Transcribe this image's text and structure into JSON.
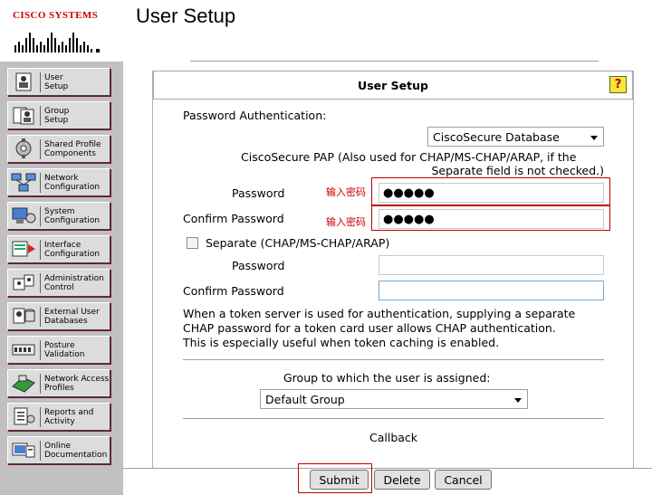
{
  "header": {
    "logo_text": "CISCO SYSTEMS",
    "page_title": "User Setup"
  },
  "sidebar": {
    "items": [
      {
        "label": "User\nSetup",
        "icon": "user-setup-icon"
      },
      {
        "label": "Group\nSetup",
        "icon": "group-setup-icon"
      },
      {
        "label": "Shared Profile\nComponents",
        "icon": "shared-profile-icon"
      },
      {
        "label": "Network\nConfiguration",
        "icon": "network-config-icon"
      },
      {
        "label": "System\nConfiguration",
        "icon": "system-config-icon"
      },
      {
        "label": "Interface\nConfiguration",
        "icon": "interface-config-icon"
      },
      {
        "label": "Administration\nControl",
        "icon": "admin-control-icon"
      },
      {
        "label": "External User\nDatabases",
        "icon": "external-db-icon"
      },
      {
        "label": "Posture\nValidation",
        "icon": "posture-icon"
      },
      {
        "label": "Network Access\nProfiles",
        "icon": "nap-icon"
      },
      {
        "label": "Reports and\nActivity",
        "icon": "reports-icon"
      },
      {
        "label": "Online\nDocumentation",
        "icon": "docs-icon"
      }
    ]
  },
  "panel": {
    "title": "User Setup",
    "help_glyph": "?"
  },
  "form": {
    "password_auth_label": "Password Authentication:",
    "auth_db_selected": "CiscoSecure Database",
    "pap_note_line1": "CiscoSecure PAP (Also used for CHAP/MS-CHAP/ARAP, if the",
    "pap_note_line2": "Separate field is not checked.)",
    "password_label": "Password",
    "confirm_password_label": "Confirm Password",
    "annotation_enter_password": "输入密码",
    "password_value": "●●●●●",
    "confirm_password_value": "●●●●●",
    "separate_label": "Separate (CHAP/MS-CHAP/ARAP)",
    "separate_password_label": "Password",
    "separate_confirm_label": "Confirm Password",
    "token_note_line1": "When a token server is used for authentication, supplying a separate",
    "token_note_line2": "CHAP password for a token card user allows CHAP authentication.",
    "token_note_line3": "This is especially useful when token caching is enabled.",
    "group_label": "Group to which the user is assigned:",
    "group_selected": "Default Group",
    "callback_label": "Callback"
  },
  "actions": {
    "submit": "Submit",
    "delete": "Delete",
    "cancel": "Cancel"
  },
  "colors": {
    "brand_red": "#cc0000",
    "sidebar_bg": "#c0c0c0",
    "annotation_red": "#c00000"
  }
}
